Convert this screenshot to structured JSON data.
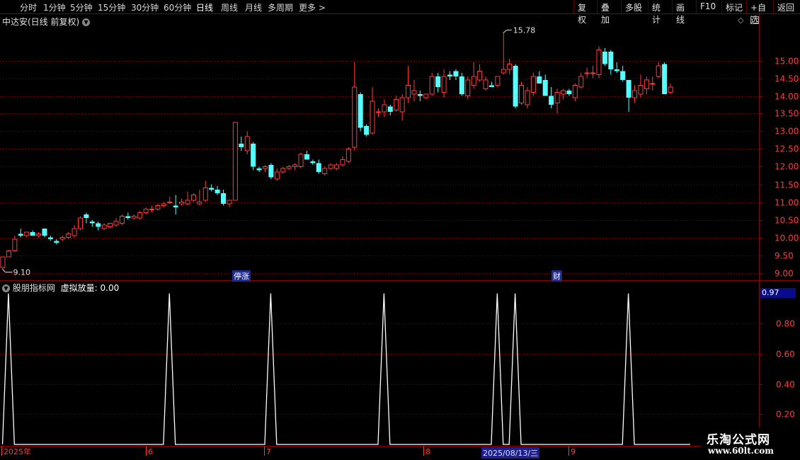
{
  "toolbar": {
    "periods": [
      "分时",
      "1分钟",
      "5分钟",
      "15分钟",
      "30分钟",
      "60分钟",
      "日线",
      "周线",
      "月线",
      "多周期",
      "更多 >"
    ],
    "active_period": "日线",
    "right_buttons": [
      "复权",
      "叠加",
      "多股",
      "统计",
      "画线",
      "F10",
      "标记",
      "+自选",
      "返回"
    ]
  },
  "main_header": {
    "title": "中达安(日线 前复权)"
  },
  "price_axis": {
    "ticks": [
      "15.00",
      "14.50",
      "14.00",
      "13.50",
      "13.00",
      "12.50",
      "12.00",
      "11.50",
      "11.00",
      "10.50",
      "10.00",
      "9.50",
      "9.00"
    ]
  },
  "annotations": {
    "high_label": "15.78",
    "low_label": "9.10",
    "tag_limit_up": "停涨",
    "tag_finance": "财"
  },
  "indicator": {
    "name": "股朋指标网",
    "series_label": "虚拟放量: 0.00",
    "current_value": "0.97",
    "ticks": [
      "0.80",
      "0.60",
      "0.40",
      "0.20"
    ]
  },
  "date_axis": {
    "labels": [
      "2025年",
      "6",
      "7",
      "8",
      "9"
    ],
    "highlight": "2025/08/13/三"
  },
  "watermark": {
    "line1": "乐淘公式网",
    "line2": "www.60lt.com"
  },
  "colors": {
    "up": "#ff3c3c",
    "down": "#54ffff",
    "grid": "#8b0000",
    "line": "#ffffff"
  },
  "chart_data": {
    "type": "candlestick",
    "ylim": [
      8.85,
      15.95
    ],
    "candles": [
      [
        9.15,
        9.45,
        9.1,
        9.45
      ],
      [
        9.45,
        9.65,
        9.45,
        9.62
      ],
      [
        9.62,
        10.05,
        9.6,
        9.95
      ],
      [
        10.1,
        10.25,
        10.0,
        10.05
      ],
      [
        10.05,
        10.15,
        10.0,
        10.15
      ],
      [
        10.15,
        10.2,
        10.05,
        10.05
      ],
      [
        10.05,
        10.15,
        10.0,
        10.1
      ],
      [
        10.25,
        10.25,
        10.0,
        10.05
      ],
      [
        10.0,
        10.05,
        9.9,
        9.95
      ],
      [
        9.9,
        9.95,
        9.8,
        9.85
      ],
      [
        9.95,
        10.05,
        9.9,
        10.0
      ],
      [
        10.0,
        10.15,
        9.95,
        10.1
      ],
      [
        10.05,
        10.35,
        10.0,
        10.25
      ],
      [
        10.25,
        10.6,
        10.2,
        10.55
      ],
      [
        10.65,
        10.7,
        10.4,
        10.55
      ],
      [
        10.45,
        10.5,
        10.3,
        10.4
      ],
      [
        10.4,
        10.45,
        10.2,
        10.3
      ],
      [
        10.25,
        10.4,
        10.2,
        10.35
      ],
      [
        10.3,
        10.4,
        10.25,
        10.4
      ],
      [
        10.35,
        10.55,
        10.3,
        10.45
      ],
      [
        10.4,
        10.65,
        10.35,
        10.6
      ],
      [
        10.6,
        10.7,
        10.5,
        10.55
      ],
      [
        10.55,
        10.65,
        10.5,
        10.6
      ],
      [
        10.55,
        10.75,
        10.5,
        10.7
      ],
      [
        10.7,
        10.85,
        10.65,
        10.8
      ],
      [
        10.8,
        10.9,
        10.7,
        10.8
      ],
      [
        10.8,
        10.95,
        10.75,
        10.9
      ],
      [
        10.9,
        11.0,
        10.85,
        10.95
      ],
      [
        11.0,
        11.15,
        10.95,
        11.0
      ],
      [
        10.9,
        11.2,
        10.65,
        10.85
      ],
      [
        10.95,
        11.1,
        10.9,
        11.0
      ],
      [
        10.95,
        11.3,
        10.9,
        11.05
      ],
      [
        11.05,
        11.25,
        11.0,
        11.2
      ],
      [
        10.95,
        11.35,
        10.9,
        11.0
      ],
      [
        11.05,
        11.6,
        11.0,
        11.4
      ],
      [
        11.4,
        11.5,
        11.3,
        11.35
      ],
      [
        11.35,
        11.45,
        11.2,
        11.25
      ],
      [
        11.25,
        11.35,
        10.9,
        10.95
      ],
      [
        10.95,
        11.05,
        10.85,
        11.05
      ],
      [
        11.05,
        13.25,
        11.05,
        13.25
      ],
      [
        12.65,
        12.85,
        12.45,
        12.55
      ],
      [
        12.45,
        13.0,
        12.35,
        12.85
      ],
      [
        12.65,
        12.7,
        11.9,
        12.0
      ],
      [
        11.95,
        12.0,
        11.85,
        11.9
      ],
      [
        11.95,
        12.05,
        11.85,
        12.0
      ],
      [
        12.05,
        12.1,
        11.65,
        11.7
      ],
      [
        11.65,
        11.95,
        11.6,
        11.85
      ],
      [
        11.85,
        12.0,
        11.8,
        11.95
      ],
      [
        11.95,
        12.05,
        11.9,
        12.0
      ],
      [
        12.0,
        12.1,
        11.9,
        12.05
      ],
      [
        12.0,
        12.4,
        11.95,
        12.35
      ],
      [
        12.35,
        12.45,
        12.2,
        12.2
      ],
      [
        12.15,
        12.2,
        12.05,
        12.1
      ],
      [
        12.1,
        12.2,
        11.8,
        11.85
      ],
      [
        11.8,
        12.0,
        11.75,
        11.95
      ],
      [
        11.95,
        12.1,
        11.9,
        12.05
      ],
      [
        11.95,
        12.1,
        11.9,
        12.05
      ],
      [
        12.05,
        12.3,
        12.0,
        12.2
      ],
      [
        12.15,
        12.55,
        12.1,
        12.5
      ],
      [
        12.55,
        14.95,
        12.45,
        14.25
      ],
      [
        14.05,
        14.1,
        13.0,
        13.1
      ],
      [
        13.15,
        13.2,
        12.85,
        12.9
      ],
      [
        12.95,
        14.25,
        12.9,
        13.85
      ],
      [
        13.55,
        13.65,
        13.4,
        13.55
      ],
      [
        13.55,
        13.9,
        13.4,
        13.75
      ],
      [
        13.7,
        13.75,
        13.45,
        13.55
      ],
      [
        13.6,
        14.0,
        13.55,
        13.9
      ],
      [
        13.55,
        14.05,
        13.3,
        13.95
      ],
      [
        13.95,
        14.85,
        13.8,
        14.3
      ],
      [
        14.05,
        14.45,
        13.85,
        14.15
      ],
      [
        14.05,
        14.15,
        13.85,
        14.0
      ],
      [
        13.95,
        14.05,
        13.9,
        14.05
      ],
      [
        14.05,
        14.65,
        14.0,
        14.55
      ],
      [
        14.55,
        14.65,
        14.1,
        14.25
      ],
      [
        14.1,
        14.75,
        13.95,
        14.55
      ],
      [
        14.6,
        14.7,
        14.45,
        14.55
      ],
      [
        14.7,
        14.75,
        14.45,
        14.55
      ],
      [
        14.55,
        14.65,
        14.0,
        14.05
      ],
      [
        14.0,
        14.55,
        13.9,
        14.45
      ],
      [
        14.3,
        14.95,
        14.2,
        14.55
      ],
      [
        14.45,
        14.9,
        14.4,
        14.7
      ],
      [
        14.2,
        14.55,
        14.15,
        14.45
      ],
      [
        14.3,
        14.4,
        14.25,
        14.25
      ],
      [
        14.3,
        14.55,
        14.25,
        14.55
      ],
      [
        14.65,
        15.78,
        14.6,
        14.75
      ],
      [
        14.75,
        15.05,
        14.6,
        14.9
      ],
      [
        14.85,
        14.9,
        13.65,
        13.7
      ],
      [
        13.8,
        14.4,
        13.75,
        14.3
      ],
      [
        13.75,
        14.25,
        13.65,
        14.15
      ],
      [
        14.1,
        14.65,
        14.0,
        14.55
      ],
      [
        14.55,
        14.7,
        14.35,
        14.35
      ],
      [
        14.45,
        14.6,
        14.0,
        14.0
      ],
      [
        14.0,
        14.25,
        13.65,
        13.75
      ],
      [
        13.8,
        14.2,
        13.5,
        14.1
      ],
      [
        14.05,
        14.2,
        13.9,
        14.15
      ],
      [
        14.15,
        14.2,
        14.0,
        14.05
      ],
      [
        13.95,
        14.35,
        13.85,
        14.3
      ],
      [
        14.25,
        14.65,
        14.2,
        14.55
      ],
      [
        14.65,
        14.8,
        14.5,
        14.65
      ],
      [
        14.65,
        14.85,
        14.5,
        14.65
      ],
      [
        14.6,
        15.4,
        14.5,
        15.3
      ],
      [
        15.25,
        15.35,
        14.85,
        14.9
      ],
      [
        15.25,
        15.3,
        14.6,
        14.75
      ],
      [
        14.75,
        14.95,
        14.65,
        14.7
      ],
      [
        14.7,
        14.85,
        14.4,
        14.45
      ],
      [
        14.45,
        14.45,
        13.55,
        13.95
      ],
      [
        13.95,
        14.3,
        13.8,
        14.15
      ],
      [
        14.05,
        14.6,
        13.95,
        14.3
      ],
      [
        14.2,
        14.55,
        14.05,
        14.45
      ],
      [
        14.35,
        14.55,
        14.15,
        14.35
      ],
      [
        14.55,
        14.95,
        14.5,
        14.85
      ],
      [
        14.9,
        14.95,
        14.05,
        14.05
      ],
      [
        14.1,
        14.35,
        14.05,
        14.25
      ]
    ],
    "indicator_peaks": [
      1,
      28,
      45,
      64,
      83,
      86,
      105
    ],
    "indicator_ylim": [
      0,
      1.05
    ]
  }
}
